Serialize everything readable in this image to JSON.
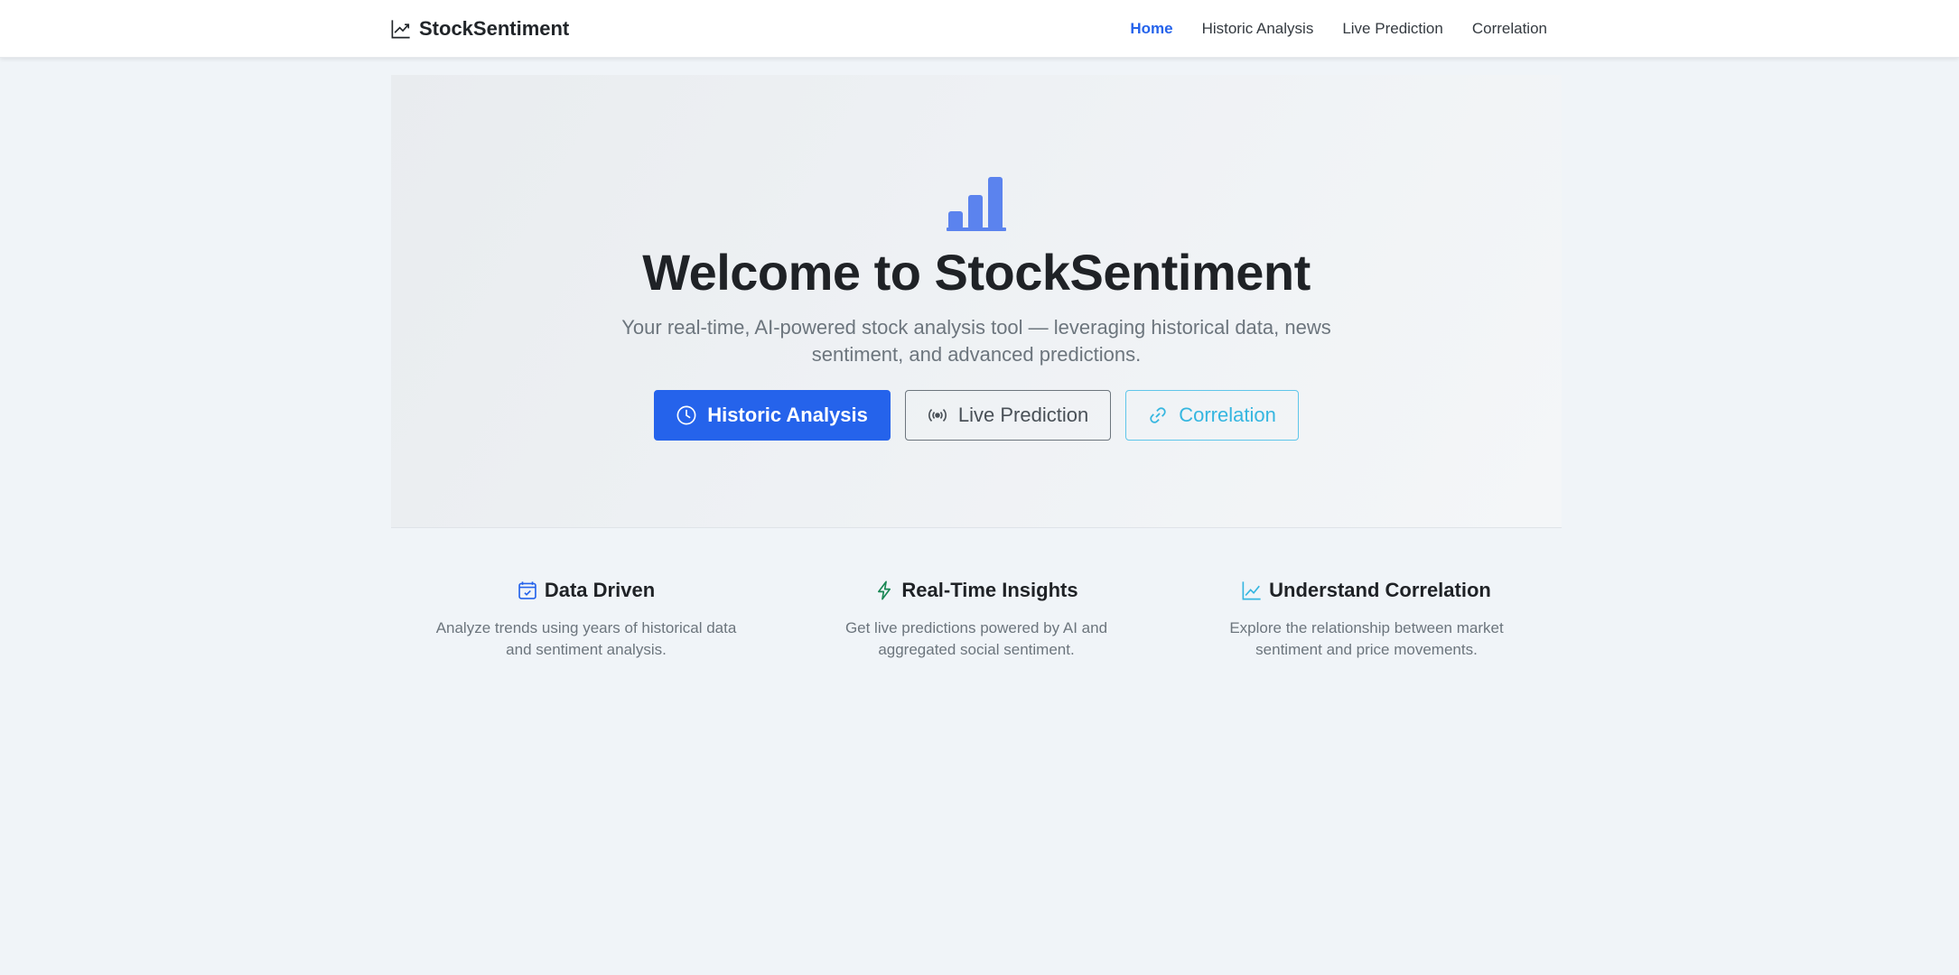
{
  "navbar": {
    "brand": "StockSentiment",
    "brand_icon": "trend-line-icon",
    "links": [
      "Home",
      "Historic Analysis",
      "Live Prediction",
      "Correlation"
    ],
    "active": "Home"
  },
  "hero": {
    "icon": "bar-chart-icon",
    "title": "Welcome to StockSentiment",
    "subtitle_line1": "Your real-time, AI-powered stock analysis tool — leveraging historical data, news",
    "subtitle_line2": "sentiment, and advanced predictions.",
    "buttons": [
      {
        "label": "Historic Analysis",
        "icon": "clock-icon"
      },
      {
        "label": "Live Prediction",
        "icon": "broadcast-icon"
      },
      {
        "label": "Correlation",
        "icon": "link-icon"
      }
    ]
  },
  "features": [
    {
      "title": "Data Driven",
      "icon": "calendar-check-icon",
      "color": "#2563eb",
      "desc_line1": "Analyze trends using years of historical data",
      "desc_line2": "and sentiment analysis."
    },
    {
      "title": "Real-Time Insights",
      "icon": "lightning-icon",
      "color": "#198754",
      "desc_line1": "Get live predictions powered by AI and",
      "desc_line2": "aggregated social sentiment."
    },
    {
      "title": "Understand Correlation",
      "icon": "graph-up-icon",
      "color": "#35b6e0",
      "desc_line1": "Explore the relationship between market",
      "desc_line2": "sentiment and price movements."
    }
  ],
  "colors": {
    "primary": "#2563eb",
    "info": "#35b6e0",
    "success": "#198754",
    "background": "#f0f4f8"
  }
}
